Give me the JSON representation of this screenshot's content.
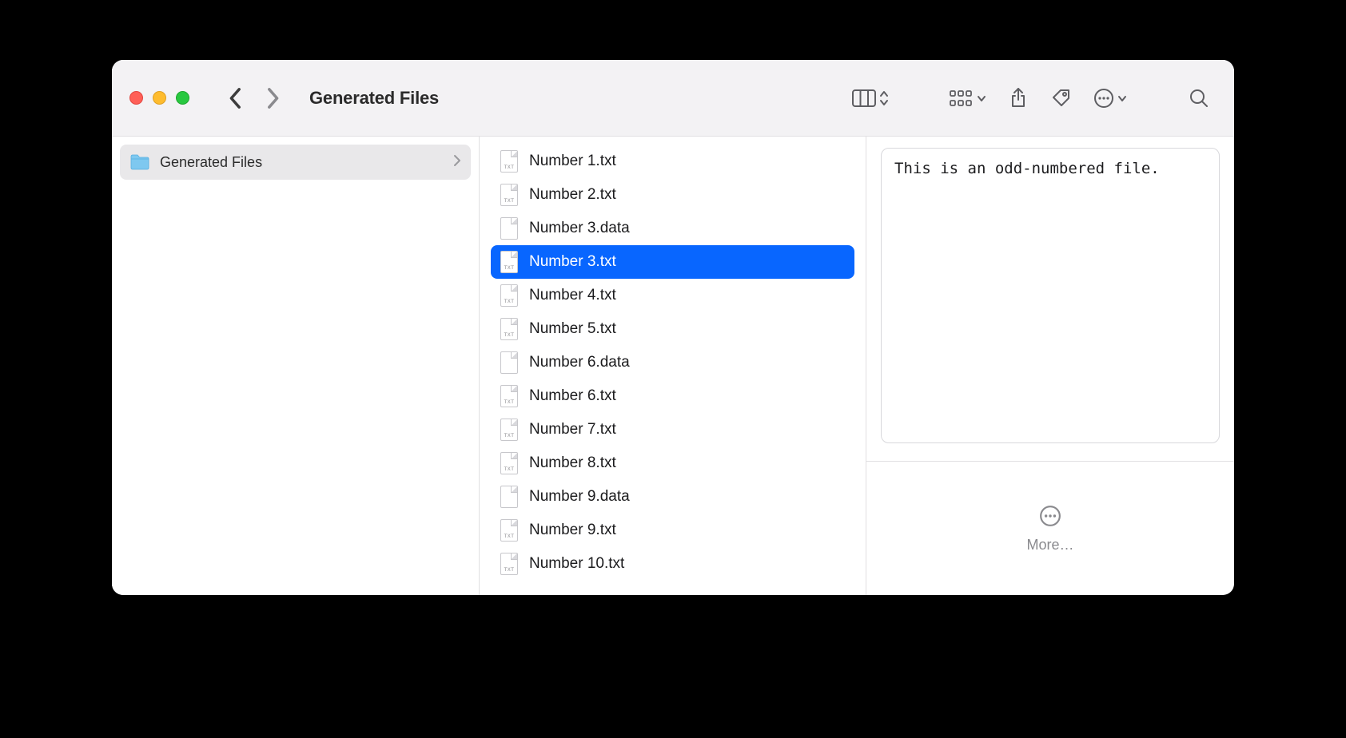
{
  "window": {
    "title": "Generated Files"
  },
  "sidebar": {
    "folder_name": "Generated Files"
  },
  "files": [
    {
      "name": "Number 1.txt",
      "kind": "txt",
      "selected": false
    },
    {
      "name": "Number 2.txt",
      "kind": "txt",
      "selected": false
    },
    {
      "name": "Number 3.data",
      "kind": "data",
      "selected": false
    },
    {
      "name": "Number 3.txt",
      "kind": "txt",
      "selected": true
    },
    {
      "name": "Number 4.txt",
      "kind": "txt",
      "selected": false
    },
    {
      "name": "Number 5.txt",
      "kind": "txt",
      "selected": false
    },
    {
      "name": "Number 6.data",
      "kind": "data",
      "selected": false
    },
    {
      "name": "Number 6.txt",
      "kind": "txt",
      "selected": false
    },
    {
      "name": "Number 7.txt",
      "kind": "txt",
      "selected": false
    },
    {
      "name": "Number 8.txt",
      "kind": "txt",
      "selected": false
    },
    {
      "name": "Number 9.data",
      "kind": "data",
      "selected": false
    },
    {
      "name": "Number 9.txt",
      "kind": "txt",
      "selected": false
    },
    {
      "name": "Number 10.txt",
      "kind": "txt",
      "selected": false
    }
  ],
  "preview": {
    "content": "This is an odd-numbered file."
  },
  "more": {
    "label": "More…"
  }
}
